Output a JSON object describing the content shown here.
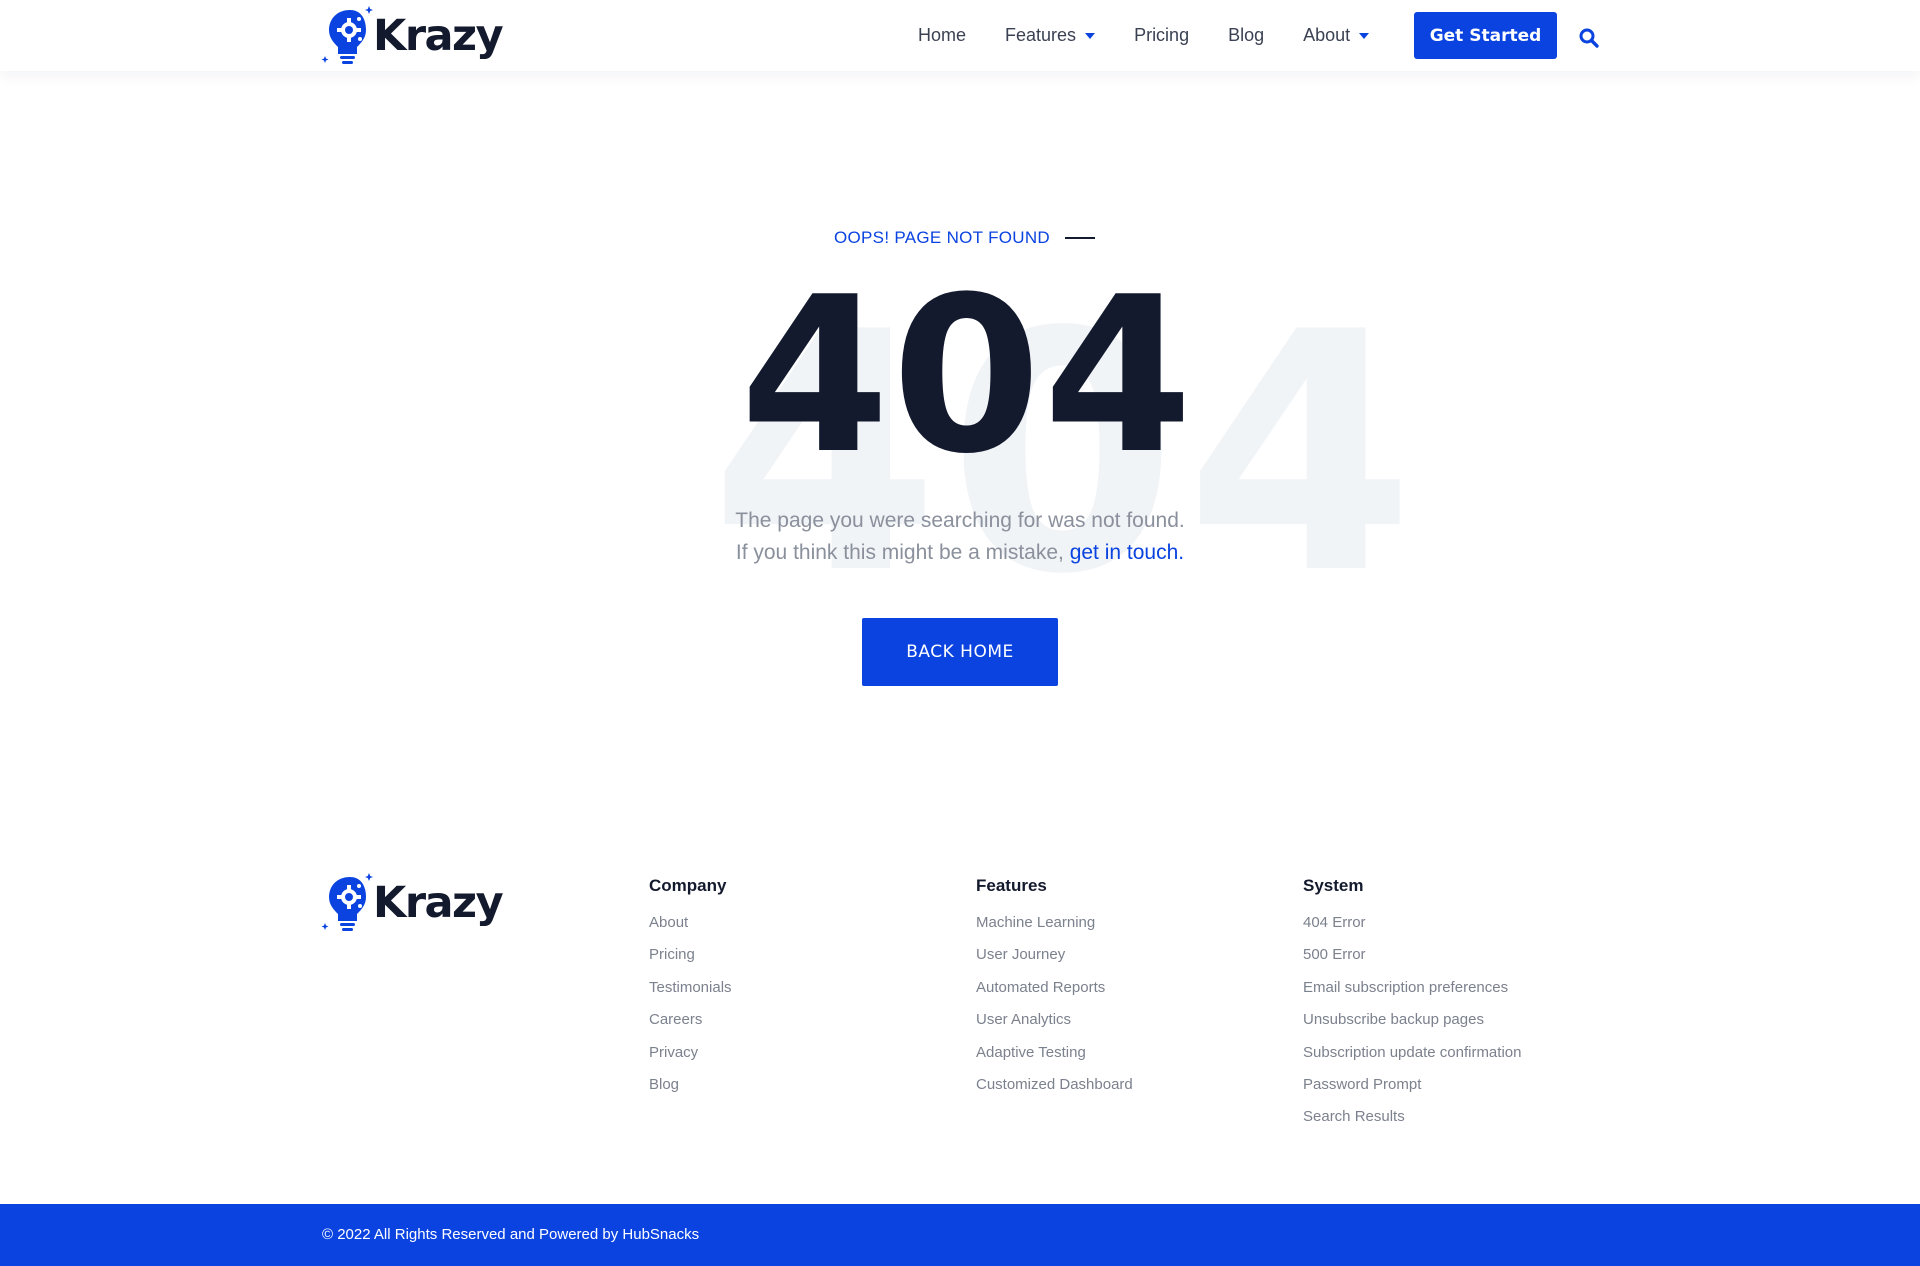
{
  "brand": {
    "name": "Krazy"
  },
  "nav": {
    "items": [
      {
        "label": "Home"
      },
      {
        "label": "Features",
        "dropdown": true
      },
      {
        "label": "Pricing"
      },
      {
        "label": "Blog"
      },
      {
        "label": "About",
        "dropdown": true
      }
    ],
    "cta_label": "Get Started",
    "search_icon": "search-icon"
  },
  "error": {
    "eyebrow": "OOPS! PAGE NOT FOUND",
    "code": "404",
    "background_code": "404",
    "line1": "The page you were searching for was not found.",
    "line2": "If you think this might be a mistake,",
    "link": "get in touch.",
    "button": "BACK HOME"
  },
  "footer": {
    "columns": [
      {
        "title": "Company",
        "links": [
          "About",
          "Pricing",
          "Testimonials",
          "Careers",
          "Privacy",
          "Blog"
        ]
      },
      {
        "title": "Features",
        "links": [
          "Machine Learning",
          "User Journey",
          "Automated Reports",
          "User Analytics",
          "Adaptive Testing",
          "Customized Dashboard"
        ]
      },
      {
        "title": "System",
        "links": [
          "404 Error",
          "500 Error",
          "Email subscription preferences",
          "Unsubscribe backup pages",
          "Subscription update confirmation",
          "Password Prompt",
          "Search Results"
        ]
      }
    ],
    "copyright": "© 2022 All Rights Reserved and Powered by HubSnacks"
  },
  "colors": {
    "accent": "#0a43e0",
    "heading": "#141a2e",
    "muted_text": "#8a909c",
    "watermark": "#f1f4f7"
  }
}
